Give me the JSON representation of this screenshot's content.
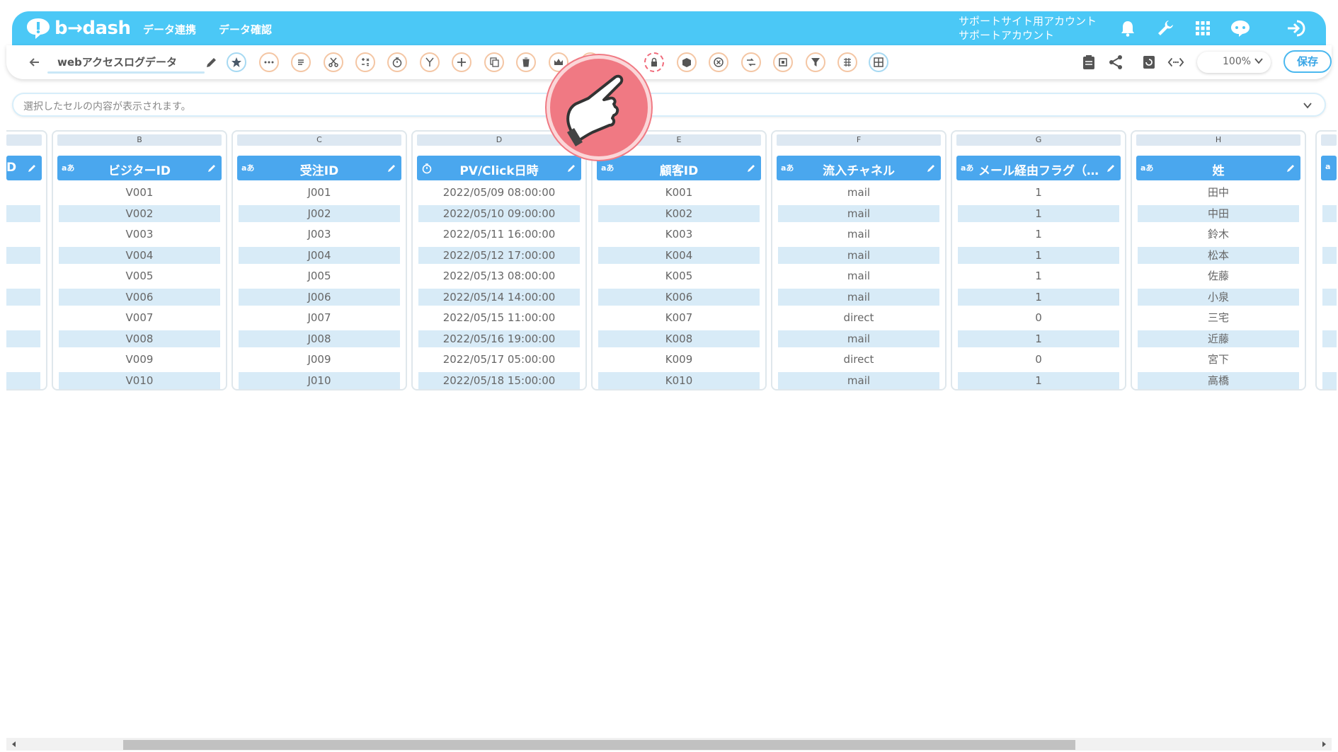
{
  "header": {
    "logo_text": "b→dash",
    "nav": [
      "データ連携",
      "データ確認"
    ],
    "account_line1": "サポートサイト用アカウント",
    "account_line2": "サポートアカウント",
    "icons": [
      "bell-icon",
      "wrench-icon",
      "grid-menu-icon",
      "support-chat-icon",
      "logout-icon"
    ]
  },
  "toolbar": {
    "title": "webアクセスログデータ",
    "tools": [
      "star-icon",
      "more-icon",
      "text-icon",
      "cut-icon",
      "calc-icon",
      "timer-icon",
      "merge-icon",
      "add-icon",
      "copy-icon",
      "delete-icon",
      "crown-icon",
      "hidden-icon",
      "lock-icon",
      "box-icon",
      "cancel-icon",
      "convert-icon",
      "frame-icon",
      "filter-icon",
      "dedupe-icon",
      "table-icon"
    ],
    "zoom": "100%",
    "save_label": "保存",
    "right_icons": [
      "clipboard-icon",
      "share-icon",
      "refresh-icon",
      "code-icon"
    ]
  },
  "cellbar": {
    "placeholder": "選択したセルの内容が表示されます。"
  },
  "columns": [
    {
      "letter": "B",
      "type": "aあ",
      "name": "ビジターID",
      "values": [
        "V001",
        "V002",
        "V003",
        "V004",
        "V005",
        "V006",
        "V007",
        "V008",
        "V009",
        "V010"
      ]
    },
    {
      "letter": "C",
      "type": "aあ",
      "name": "受注ID",
      "values": [
        "J001",
        "J002",
        "J003",
        "J004",
        "J005",
        "J006",
        "J007",
        "J008",
        "J009",
        "J010"
      ]
    },
    {
      "letter": "D",
      "type": "clock",
      "name": "PV/Click日時",
      "values": [
        "2022/05/09 08:00:00",
        "2022/05/10 09:00:00",
        "2022/05/11 16:00:00",
        "2022/05/12 17:00:00",
        "2022/05/13 08:00:00",
        "2022/05/14 14:00:00",
        "2022/05/15 11:00:00",
        "2022/05/16 19:00:00",
        "2022/05/17 05:00:00",
        "2022/05/18 15:00:00"
      ]
    },
    {
      "letter": "E",
      "type": "aあ",
      "name": "顧客ID",
      "values": [
        "K001",
        "K002",
        "K003",
        "K004",
        "K005",
        "K006",
        "K007",
        "K008",
        "K009",
        "K010"
      ]
    },
    {
      "letter": "F",
      "type": "aあ",
      "name": "流入チャネル",
      "values": [
        "mail",
        "mail",
        "mail",
        "mail",
        "mail",
        "mail",
        "direct",
        "mail",
        "direct",
        "mail"
      ]
    },
    {
      "letter": "G",
      "type": "aあ",
      "name": "メール経由フラグ（…",
      "values": [
        "1",
        "1",
        "1",
        "1",
        "1",
        "1",
        "0",
        "1",
        "0",
        "1"
      ]
    },
    {
      "letter": "H",
      "type": "aあ",
      "name": "姓",
      "values": [
        "田中",
        "中田",
        "鈴木",
        "松本",
        "佐藤",
        "小泉",
        "三宅",
        "近藤",
        "宮下",
        "高橋"
      ]
    }
  ],
  "colors": {
    "header": "#4bc8f6",
    "column_header": "#4aa7ee",
    "row_alt": "#d8ebf7",
    "pointer": "#f07983"
  }
}
